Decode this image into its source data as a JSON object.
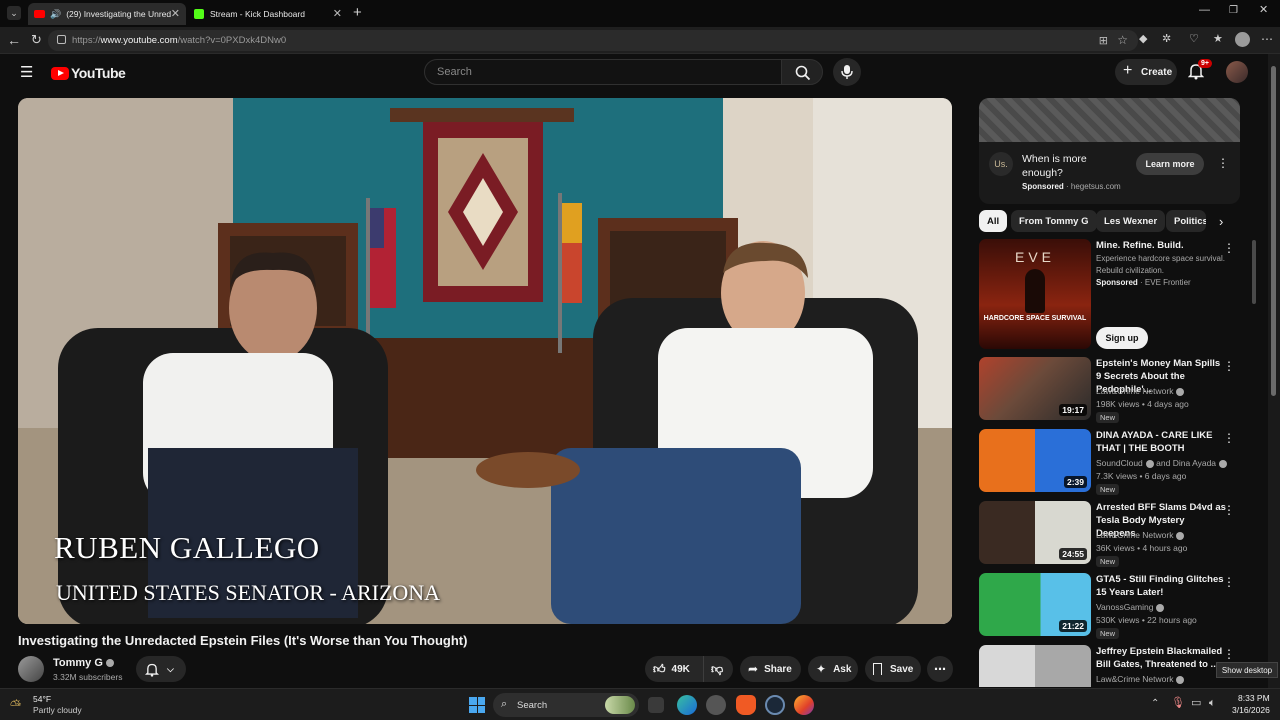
{
  "browser": {
    "tabs": [
      {
        "label": "(29) Investigating the Unreda",
        "active": true
      },
      {
        "label": "Stream - Kick Dashboard",
        "active": false
      }
    ],
    "url_prefix": "https://",
    "url_host": "www.youtube.com",
    "url_path": "/watch?v=0PXDxk4DNw0"
  },
  "header": {
    "logo": "YouTube",
    "search_placeholder": "Search",
    "create_label": "Create",
    "notifications_badge": "9+"
  },
  "video": {
    "overlay_name": "RUBEN GALLEGO",
    "overlay_title": "UNITED STATES SENATOR - ARIZONA",
    "title": "Investigating the Unredacted Epstein Files (It's Worse than You Thought)",
    "channel": "Tommy G",
    "subscribers": "3.32M subscribers",
    "likes": "49K",
    "share_label": "Share",
    "ask_label": "Ask",
    "save_label": "Save"
  },
  "ad": {
    "logo_text": "Us.",
    "headline": "When is more enough?",
    "sponsored": "Sponsored",
    "domain": "hegetsus.com",
    "cta": "Learn more"
  },
  "chips": [
    "All",
    "From Tommy G",
    "Les Wexner",
    "Politics"
  ],
  "promo": {
    "title": "Mine. Refine. Build.",
    "desc": "Experience hardcore space survival. Rebuild civilization.",
    "sponsored": "Sponsored",
    "advertiser": "EVE Frontier",
    "cta": "Sign up",
    "thumb_brand": "EVE",
    "thumb_caption": "HARDCORE SPACE SURVIVAL"
  },
  "recommendations": [
    {
      "title": "Epstein's Money Man Spills 9 Secrets About the Pedophile'...",
      "channel": "Law&Crime Network",
      "meta": "198K views • 4 days ago",
      "duration": "19:17",
      "badge": "New",
      "thumb_color": "#6b4a3a"
    },
    {
      "title": "DINA AYADA - CARE LIKE THAT | THE BOOTH",
      "channel": "SoundCloud",
      "channel_extra": "and Dina Ayada",
      "meta": "7.3K views • 6 days ago",
      "duration": "2:39",
      "badge": "New",
      "thumb_color": "#e86a1c"
    },
    {
      "title": "Arrested BFF Slams D4vd as Tesla Body Mystery Deepens",
      "channel": "Law&Crime Network",
      "meta": "36K views • 4 hours ago",
      "duration": "24:55",
      "badge": "New",
      "thumb_color": "#4a4a4a"
    },
    {
      "title": "GTA5 - Still Finding Glitches 15 Years Later!",
      "channel": "VanossGaming",
      "meta": "530K views • 22 hours ago",
      "duration": "21:22",
      "badge": "New",
      "thumb_color": "#2fa84a"
    },
    {
      "title": "Jeffrey Epstein Blackmailed Bill Gates, Threatened to ...",
      "channel": "Law&Crime Network",
      "meta": "",
      "duration": "",
      "badge": "",
      "thumb_color": "#c8c8c8"
    }
  ],
  "taskbar": {
    "temp": "54°F",
    "weather": "Partly cloudy",
    "search": "Search",
    "time": "8:33 PM",
    "date": "3/16/2026",
    "tooltip": "Show desktop"
  }
}
